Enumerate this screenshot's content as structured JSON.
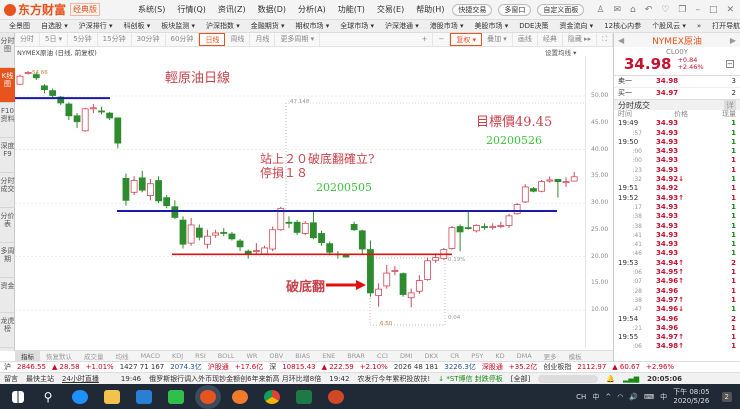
{
  "app": {
    "logo": "东方财富",
    "edition": "经典版",
    "menu": [
      "系统(S)",
      "行情(Q)",
      "资讯(Z)",
      "数据(D)",
      "分析(A)",
      "功能(T)",
      "交易(E)",
      "帮助(H)"
    ],
    "buttons": [
      "快捷交易",
      "多窗口",
      "自定义面板"
    ]
  },
  "nav": [
    "全景图",
    "自选股 ▾",
    "沪深排行 ▾",
    "科创板 ▾",
    "板块监测 ▾",
    "沪深指数 ▾",
    "金融期货 ▾",
    "期权市场 ▾",
    "全球市场 ▾",
    "沪深港通 ▾",
    "港股市场 ▾",
    "美股市场 ▾",
    "DDE决策",
    "资金流向 ▾",
    "12核心内参",
    "个股风云 ▾",
    "»",
    "打开导航",
    "返回"
  ],
  "periods": [
    "分时",
    "5日 ▾",
    "5分钟",
    "15分钟",
    "30分钟",
    "60分钟",
    "日线",
    "周线",
    "月线",
    "更多周期 ▾"
  ],
  "period_tools": [
    "+",
    "−",
    "复权 ▾",
    "叠加 ▾",
    "画线",
    "经典",
    "隐藏 ▸▸",
    "⛶"
  ],
  "side_tabs": [
    "分时图",
    "K线图",
    "F10资料",
    "深度F9",
    "分时成交",
    "分价表",
    "多周期",
    "资金",
    "龙虎榜"
  ],
  "chart": {
    "header": "NYMEX原油 (日线, 前复权)",
    "set_ma": "设置均线 ▾",
    "y_ticks": [
      "50.00",
      "45.00",
      "40.00",
      "35.00",
      "30.00",
      "25.00",
      "20.00",
      "15.00",
      "10.00"
    ],
    "labels": {
      "high": "54.66",
      "mark1": "47.148",
      "low": "6.50",
      "pct1": "0.04",
      "pct2": "0.19%"
    },
    "annotations": {
      "title": "輕原油日線",
      "line1": "站上２０破底翻確立?",
      "line2": "停損１８",
      "date1": "20200505",
      "target": "目標價49.45",
      "date2": "20200526",
      "breakout": "破底翻"
    },
    "colors": {
      "up": "#d0495a",
      "down": "#2e8b2e",
      "support": "#1a1aa8",
      "stop": "#e01010"
    },
    "levels": {
      "top_line": 49.6,
      "support": 28.5,
      "stop": 20.4
    }
  },
  "chart_data": {
    "type": "candlestick",
    "fields": [
      "open",
      "close",
      "high",
      "low"
    ],
    "ylim": [
      8,
      55
    ],
    "candles": [
      [
        52.2,
        53.7,
        54,
        52
      ],
      [
        54.2,
        54.4,
        54.66,
        54
      ],
      [
        54,
        53.4,
        54.3,
        53
      ],
      [
        51.9,
        51.2,
        52.2,
        50.5
      ],
      [
        51,
        50.1,
        51.4,
        49.5
      ],
      [
        49.8,
        48.7,
        50,
        48.3
      ],
      [
        48.5,
        46.3,
        48.8,
        45.5
      ],
      [
        46.3,
        45.2,
        46.8,
        44
      ],
      [
        43.5,
        47.6,
        47.8,
        43.3
      ],
      [
        47.6,
        47.8,
        48.5,
        46.8
      ],
      [
        47.2,
        47.1,
        48,
        46.6
      ],
      [
        46.8,
        45.9,
        47,
        45.5
      ],
      [
        45.9,
        41.2,
        46,
        40.2
      ],
      [
        34.6,
        30.5,
        35.5,
        29.5
      ],
      [
        32,
        34.2,
        35,
        31.5
      ],
      [
        34.7,
        32.4,
        36,
        32
      ],
      [
        31.4,
        33.6,
        34.5,
        30.5
      ],
      [
        34.2,
        30.4,
        35,
        30
      ],
      [
        31,
        29.5,
        31.5,
        29
      ],
      [
        29.3,
        27.3,
        30.5,
        27
      ],
      [
        26.8,
        22.3,
        27.5,
        21.5
      ],
      [
        22.5,
        25.9,
        27.2,
        22
      ],
      [
        25.3,
        23.6,
        26,
        23
      ],
      [
        22.3,
        23.8,
        25,
        21.5
      ],
      [
        24,
        24.4,
        25,
        23.5
      ],
      [
        24.5,
        24.4,
        25.3,
        23.8
      ],
      [
        24.2,
        23.3,
        24.6,
        23
      ],
      [
        22.9,
        21.8,
        23.3,
        21
      ],
      [
        21,
        20.5,
        21.3,
        19.6
      ],
      [
        21,
        21.1,
        22.5,
        20.5
      ],
      [
        20.5,
        21.6,
        22,
        20.3
      ],
      [
        21.4,
        25,
        25.6,
        21
      ],
      [
        25,
        29,
        29.3,
        24.8
      ],
      [
        26.4,
        26.2,
        27.5,
        25.3
      ],
      [
        26.4,
        24.5,
        26.8,
        24
      ],
      [
        24.3,
        26.2,
        26.6,
        24
      ],
      [
        26.3,
        23.5,
        28.6,
        23.2
      ],
      [
        24.3,
        22.6,
        24.8,
        22
      ],
      [
        22.4,
        20.8,
        22.8,
        20.2
      ],
      [
        20.5,
        20.4,
        21,
        19.6
      ],
      [
        20.2,
        19.9,
        20.4,
        19.8
      ],
      [
        26,
        25,
        26.5,
        24.8
      ],
      [
        24.8,
        21.4,
        25,
        20.5
      ],
      [
        21.3,
        13.2,
        23,
        12.5
      ],
      [
        12.7,
        13.9,
        15,
        10.6
      ],
      [
        14.5,
        16.9,
        18.4,
        14
      ],
      [
        17.2,
        17.4,
        18.2,
        16.5
      ],
      [
        16.8,
        12.9,
        17,
        12.5
      ],
      [
        12.3,
        13.2,
        14,
        10.5
      ],
      [
        13.5,
        15.5,
        16.5,
        13
      ],
      [
        15.7,
        19.2,
        19.8,
        15.5
      ],
      [
        19.3,
        19.8,
        20.6,
        18.8
      ],
      [
        19.6,
        21.3,
        21.6,
        19.3
      ],
      [
        21.5,
        25.4,
        25.7,
        21.3
      ],
      [
        25.6,
        24.6,
        26,
        21
      ],
      [
        25.4,
        25.3,
        28.5,
        25
      ],
      [
        24.8,
        25.8,
        26,
        24.5
      ],
      [
        25.6,
        25.5,
        26.2,
        25
      ],
      [
        25.4,
        25.6,
        26.2,
        25
      ],
      [
        25.7,
        25.8,
        26.5,
        25.3
      ],
      [
        25.8,
        27.6,
        28,
        25.3
      ],
      [
        28,
        29.7,
        30,
        27.8
      ],
      [
        30.2,
        33,
        33.5,
        30
      ],
      [
        32.7,
        32.2,
        33,
        32
      ],
      [
        32.2,
        34,
        34.3,
        32
      ],
      [
        34.1,
        34.3,
        35,
        33.8
      ],
      [
        34.4,
        34,
        34.5,
        31
      ],
      [
        33.8,
        34,
        34.8,
        33
      ],
      [
        34.1,
        34.9,
        35.8,
        34
      ]
    ]
  },
  "indicators": [
    "指标",
    "恢复默认",
    "成交量",
    "均线",
    "MACD",
    "KDJ",
    "RSI",
    "BOLL",
    "WR",
    "OBV",
    "BIAS",
    "ENE",
    "BRAR",
    "CCI",
    "DMI",
    "DKX",
    "CR",
    "PSY",
    "KD",
    "DMA",
    "更多",
    "模板"
  ],
  "quote": {
    "name": "NYMEX原油",
    "code": "CL00Y",
    "price": "34.98",
    "change": "+0.84",
    "pct": "+2.46%",
    "sell1": {
      "label": "卖一",
      "price": "34.98",
      "vol": "3"
    },
    "buy1": {
      "label": "买一",
      "price": "34.97",
      "vol": "2"
    },
    "ticks_title": "分时成交",
    "detail": "详",
    "cols": [
      "时间",
      "价格",
      "现量"
    ],
    "ticks": [
      {
        "t": "19:49",
        "p": "34.93",
        "v": "1",
        "c": "g"
      },
      {
        "t": ":57",
        "p": "34.93",
        "v": "1",
        "c": "g"
      },
      {
        "t": "19:50",
        "p": "34.93",
        "v": "1",
        "c": "g"
      },
      {
        "t": ":00",
        "p": "34.93",
        "v": "1",
        "c": "g"
      },
      {
        "t": ":00",
        "p": "34.93",
        "v": "1",
        "c": "r"
      },
      {
        "t": ":23",
        "p": "34.93",
        "v": "1",
        "c": "r"
      },
      {
        "t": ":32",
        "p": "34.92↓",
        "v": "1",
        "c": "g"
      },
      {
        "t": "19:51",
        "p": "34.92",
        "v": "1",
        "c": "r"
      },
      {
        "t": "19:52",
        "p": "34.93↑",
        "v": "1",
        "c": "r"
      },
      {
        "t": ":17",
        "p": "34.93",
        "v": "1",
        "c": "g"
      },
      {
        "t": ":38",
        "p": "34.93",
        "v": "1",
        "c": "g"
      },
      {
        "t": ":38",
        "p": "34.93",
        "v": "1",
        "c": "g"
      },
      {
        "t": ":41",
        "p": "34.93",
        "v": "1",
        "c": "g"
      },
      {
        "t": ":41",
        "p": "34.93",
        "v": "1",
        "c": "g"
      },
      {
        "t": ":46",
        "p": "34.93",
        "v": "1",
        "c": "g"
      },
      {
        "t": "19:53",
        "p": "34.94↑",
        "v": "2",
        "c": "r"
      },
      {
        "t": ":06",
        "p": "34.95↑",
        "v": "1",
        "c": "r"
      },
      {
        "t": ":07",
        "p": "34.96↑",
        "v": "1",
        "c": "r"
      },
      {
        "t": ":28",
        "p": "34.96",
        "v": "1",
        "c": "r"
      },
      {
        "t": ":38",
        "p": "34.97↑",
        "v": "1",
        "c": "r"
      },
      {
        "t": ":47",
        "p": "34.96↓",
        "v": "1",
        "c": "g"
      },
      {
        "t": "19:54",
        "p": "34.96",
        "v": "2",
        "c": "r"
      },
      {
        "t": ":21",
        "p": "34.96",
        "v": "1",
        "c": "r"
      },
      {
        "t": "19:55",
        "p": "34.97↑",
        "v": "1",
        "c": "r"
      },
      {
        "t": ":06",
        "p": "34.98↑",
        "v": "1",
        "c": "r"
      }
    ]
  },
  "ticker": {
    "sh": "沪",
    "sh_idx": "2846.55",
    "sh_chg": "▲ 28.58",
    "sh_pct": "+1.01%",
    "sh_breadth": "1427 71 167",
    "sh_amt": "2074.3亿",
    "hgt": "沪股通",
    "hgt_v": "+17.6亿",
    "sz": "深",
    "sz_idx": "10815.43",
    "sz_chg": "▲ 222.59",
    "sz_pct": "+2.10%",
    "sz_breadth": "2026 48 181",
    "sz_amt": "3226.3亿",
    "sgt": "深股通",
    "sgt_v": "+35.2亿",
    "cyb": "创业板指",
    "cyb_idx": "2112.97",
    "cyb_chg": "▲ 60.67",
    "cyb_pct": "+2.96%"
  },
  "news": {
    "msg": "留言",
    "site": "最快主站",
    "live": "24小时直播",
    "t1": "19:46",
    "n1": "俄罗斯银行调入外币现钞金额创6年来新高 月环比增8倍",
    "t2": "19:42",
    "n2": "农发行今年累积投放扶!",
    "alert": "↓ *ST博信  封跌停板",
    "all": "[全部]",
    "clock": "20:05:06"
  },
  "taskbar": {
    "lang": "CH",
    "ime": "中",
    "ime2": "中",
    "time": "下午 08:05",
    "date": "2020/5/26",
    "notif": "2"
  }
}
